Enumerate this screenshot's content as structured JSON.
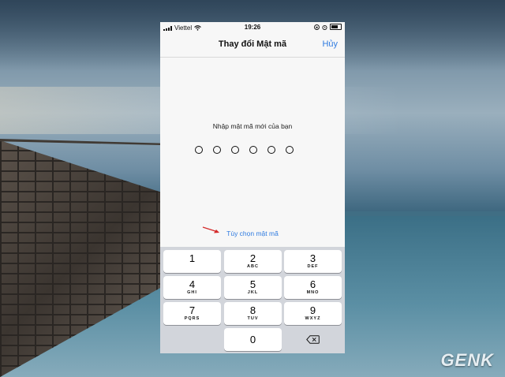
{
  "status": {
    "carrier": "Viettel",
    "time": "19:26"
  },
  "nav": {
    "title": "Thay đổi Mật mã",
    "cancel": "Hủy"
  },
  "prompt": "Nhập mật mã mới của bạn",
  "passcode_digits": 6,
  "passcode_options": "Tùy chọn mật mã",
  "keys": [
    {
      "num": "1",
      "letters": ""
    },
    {
      "num": "2",
      "letters": "ABC"
    },
    {
      "num": "3",
      "letters": "DEF"
    },
    {
      "num": "4",
      "letters": "GHI"
    },
    {
      "num": "5",
      "letters": "JKL"
    },
    {
      "num": "6",
      "letters": "MNO"
    },
    {
      "num": "7",
      "letters": "PQRS"
    },
    {
      "num": "8",
      "letters": "TUV"
    },
    {
      "num": "9",
      "letters": "WXYZ"
    },
    {
      "num": "0",
      "letters": ""
    }
  ],
  "watermark": "GENK",
  "colors": {
    "accent": "#2f7be0",
    "keypad_bg": "#d2d5db",
    "arrow": "#d42a2a"
  }
}
